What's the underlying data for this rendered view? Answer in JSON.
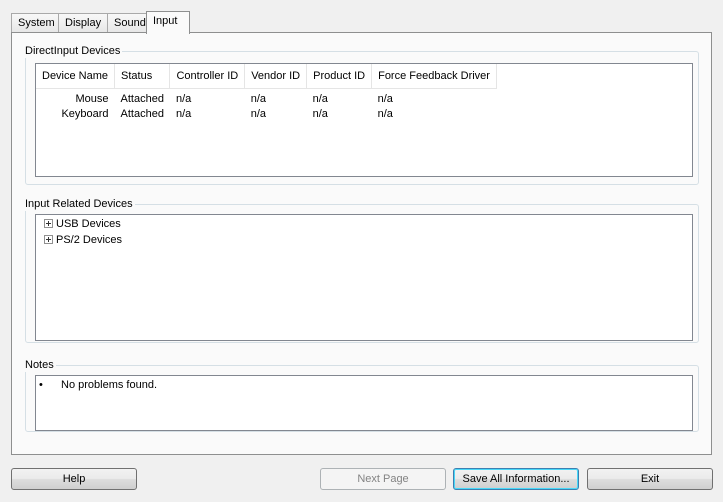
{
  "tabs": [
    {
      "label": "System"
    },
    {
      "label": "Display"
    },
    {
      "label": "Sound"
    },
    {
      "label": "Input"
    }
  ],
  "active_tab": "Input",
  "directinput": {
    "title": "DirectInput Devices",
    "columns": [
      "Device Name",
      "Status",
      "Controller ID",
      "Vendor ID",
      "Product ID",
      "Force Feedback Driver"
    ],
    "rows": [
      [
        "Mouse",
        "Attached",
        "n/a",
        "n/a",
        "n/a",
        "n/a"
      ],
      [
        "Keyboard",
        "Attached",
        "n/a",
        "n/a",
        "n/a",
        "n/a"
      ]
    ]
  },
  "related": {
    "title": "Input Related Devices",
    "items": [
      {
        "label": "USB Devices",
        "icon": "plus-expander-icon"
      },
      {
        "label": "PS/2 Devices",
        "icon": "plus-expander-icon"
      }
    ]
  },
  "notes": {
    "title": "Notes",
    "bullet": "•",
    "items": [
      "No problems found."
    ]
  },
  "buttons": {
    "help": "Help",
    "next_page": "Next Page",
    "save_all": "Save All Information...",
    "exit": "Exit"
  }
}
